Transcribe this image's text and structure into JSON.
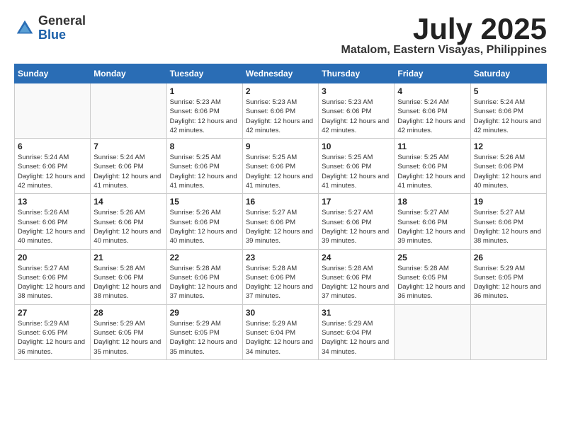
{
  "header": {
    "logo_general": "General",
    "logo_blue": "Blue",
    "month_title": "July 2025",
    "location": "Matalom, Eastern Visayas, Philippines"
  },
  "weekdays": [
    "Sunday",
    "Monday",
    "Tuesday",
    "Wednesday",
    "Thursday",
    "Friday",
    "Saturday"
  ],
  "weeks": [
    [
      {
        "day": "",
        "info": ""
      },
      {
        "day": "",
        "info": ""
      },
      {
        "day": "1",
        "sunrise": "5:23 AM",
        "sunset": "6:06 PM",
        "daylight": "12 hours and 42 minutes."
      },
      {
        "day": "2",
        "sunrise": "5:23 AM",
        "sunset": "6:06 PM",
        "daylight": "12 hours and 42 minutes."
      },
      {
        "day": "3",
        "sunrise": "5:23 AM",
        "sunset": "6:06 PM",
        "daylight": "12 hours and 42 minutes."
      },
      {
        "day": "4",
        "sunrise": "5:24 AM",
        "sunset": "6:06 PM",
        "daylight": "12 hours and 42 minutes."
      },
      {
        "day": "5",
        "sunrise": "5:24 AM",
        "sunset": "6:06 PM",
        "daylight": "12 hours and 42 minutes."
      }
    ],
    [
      {
        "day": "6",
        "sunrise": "5:24 AM",
        "sunset": "6:06 PM",
        "daylight": "12 hours and 42 minutes."
      },
      {
        "day": "7",
        "sunrise": "5:24 AM",
        "sunset": "6:06 PM",
        "daylight": "12 hours and 41 minutes."
      },
      {
        "day": "8",
        "sunrise": "5:25 AM",
        "sunset": "6:06 PM",
        "daylight": "12 hours and 41 minutes."
      },
      {
        "day": "9",
        "sunrise": "5:25 AM",
        "sunset": "6:06 PM",
        "daylight": "12 hours and 41 minutes."
      },
      {
        "day": "10",
        "sunrise": "5:25 AM",
        "sunset": "6:06 PM",
        "daylight": "12 hours and 41 minutes."
      },
      {
        "day": "11",
        "sunrise": "5:25 AM",
        "sunset": "6:06 PM",
        "daylight": "12 hours and 41 minutes."
      },
      {
        "day": "12",
        "sunrise": "5:26 AM",
        "sunset": "6:06 PM",
        "daylight": "12 hours and 40 minutes."
      }
    ],
    [
      {
        "day": "13",
        "sunrise": "5:26 AM",
        "sunset": "6:06 PM",
        "daylight": "12 hours and 40 minutes."
      },
      {
        "day": "14",
        "sunrise": "5:26 AM",
        "sunset": "6:06 PM",
        "daylight": "12 hours and 40 minutes."
      },
      {
        "day": "15",
        "sunrise": "5:26 AM",
        "sunset": "6:06 PM",
        "daylight": "12 hours and 40 minutes."
      },
      {
        "day": "16",
        "sunrise": "5:27 AM",
        "sunset": "6:06 PM",
        "daylight": "12 hours and 39 minutes."
      },
      {
        "day": "17",
        "sunrise": "5:27 AM",
        "sunset": "6:06 PM",
        "daylight": "12 hours and 39 minutes."
      },
      {
        "day": "18",
        "sunrise": "5:27 AM",
        "sunset": "6:06 PM",
        "daylight": "12 hours and 39 minutes."
      },
      {
        "day": "19",
        "sunrise": "5:27 AM",
        "sunset": "6:06 PM",
        "daylight": "12 hours and 38 minutes."
      }
    ],
    [
      {
        "day": "20",
        "sunrise": "5:27 AM",
        "sunset": "6:06 PM",
        "daylight": "12 hours and 38 minutes."
      },
      {
        "day": "21",
        "sunrise": "5:28 AM",
        "sunset": "6:06 PM",
        "daylight": "12 hours and 38 minutes."
      },
      {
        "day": "22",
        "sunrise": "5:28 AM",
        "sunset": "6:06 PM",
        "daylight": "12 hours and 37 minutes."
      },
      {
        "day": "23",
        "sunrise": "5:28 AM",
        "sunset": "6:06 PM",
        "daylight": "12 hours and 37 minutes."
      },
      {
        "day": "24",
        "sunrise": "5:28 AM",
        "sunset": "6:06 PM",
        "daylight": "12 hours and 37 minutes."
      },
      {
        "day": "25",
        "sunrise": "5:28 AM",
        "sunset": "6:05 PM",
        "daylight": "12 hours and 36 minutes."
      },
      {
        "day": "26",
        "sunrise": "5:29 AM",
        "sunset": "6:05 PM",
        "daylight": "12 hours and 36 minutes."
      }
    ],
    [
      {
        "day": "27",
        "sunrise": "5:29 AM",
        "sunset": "6:05 PM",
        "daylight": "12 hours and 36 minutes."
      },
      {
        "day": "28",
        "sunrise": "5:29 AM",
        "sunset": "6:05 PM",
        "daylight": "12 hours and 35 minutes."
      },
      {
        "day": "29",
        "sunrise": "5:29 AM",
        "sunset": "6:05 PM",
        "daylight": "12 hours and 35 minutes."
      },
      {
        "day": "30",
        "sunrise": "5:29 AM",
        "sunset": "6:04 PM",
        "daylight": "12 hours and 34 minutes."
      },
      {
        "day": "31",
        "sunrise": "5:29 AM",
        "sunset": "6:04 PM",
        "daylight": "12 hours and 34 minutes."
      },
      {
        "day": "",
        "info": ""
      },
      {
        "day": "",
        "info": ""
      }
    ]
  ],
  "labels": {
    "sunrise": "Sunrise:",
    "sunset": "Sunset:",
    "daylight": "Daylight:"
  }
}
